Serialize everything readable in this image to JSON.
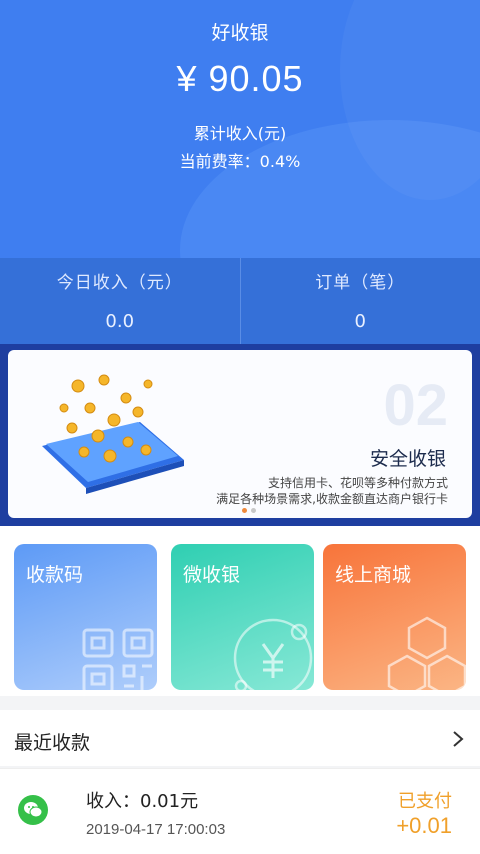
{
  "header": {
    "title": "好收银",
    "amount": "¥ 90.05",
    "amount_label": "累计收入(元)",
    "rate": "当前费率：0.4%"
  },
  "stats": [
    {
      "label": "今日收入（元）",
      "value": "0.0"
    },
    {
      "label": "订单（笔）",
      "value": "0"
    }
  ],
  "banner": {
    "number": "02",
    "title": "安全收银",
    "line1": "支持信用卡、花呗等多种付款方式",
    "line2": "满足各种场景需求,收款金额直达商户银行卡",
    "slide_count": 2,
    "active_slide": 1
  },
  "features": [
    {
      "label": "收款码",
      "icon": "qr-code-icon"
    },
    {
      "label": "微收银",
      "icon": "yuan-coin-icon"
    },
    {
      "label": "线上商城",
      "icon": "hexagon-icon"
    }
  ],
  "recent": {
    "title": "最近收款",
    "transactions": [
      {
        "income": "收入：0.01元",
        "time": "2019-04-17 17:00:03",
        "status": "已支付",
        "amount": "+0.01",
        "icon": "wechat-icon"
      }
    ]
  },
  "colors": {
    "primary": "#3f7ef0",
    "status": "#f0a02a"
  }
}
